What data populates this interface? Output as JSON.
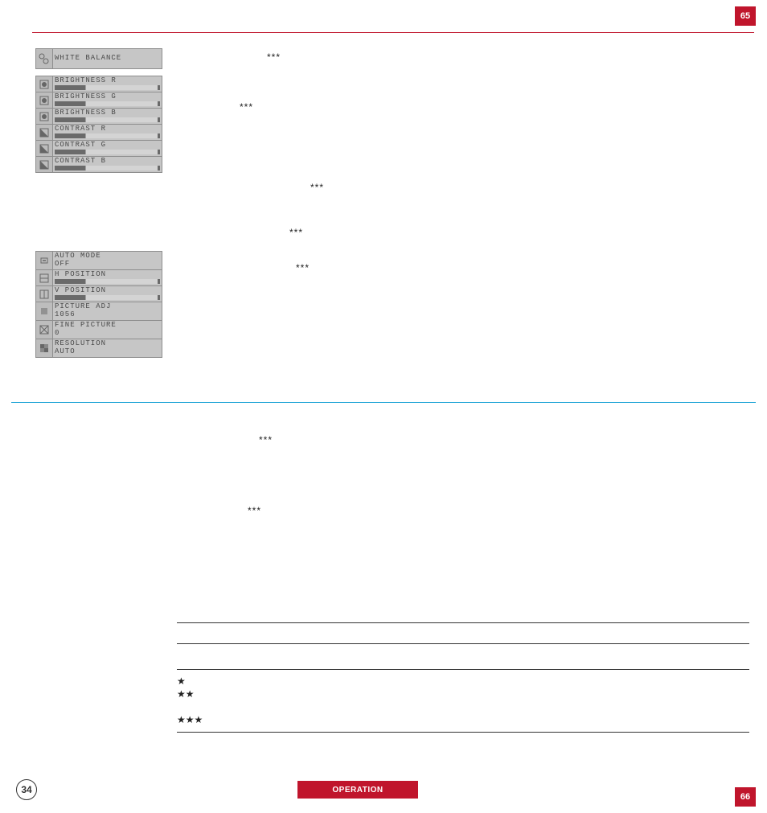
{
  "page_badges": {
    "top_right": "65",
    "bottom_right": "66",
    "bottom_left_circle": "34"
  },
  "footer_label": "OPERATION",
  "asterisk_marks": {
    "s1": "***",
    "s2": "***",
    "s3": "***",
    "s4": "***",
    "s5": "***",
    "s6": "***",
    "s7": "***"
  },
  "footnotes": {
    "star1": "★",
    "star2": "★★",
    "star3": "★★★"
  },
  "osd_menu_1": {
    "header": "WHITE BALANCE"
  },
  "osd_menu_2": {
    "rows": [
      {
        "label": "BRIGHTNESS R"
      },
      {
        "label": "BRIGHTNESS G"
      },
      {
        "label": "BRIGHTNESS B"
      },
      {
        "label": "CONTRAST R"
      },
      {
        "label": "CONTRAST G"
      },
      {
        "label": "CONTRAST B"
      }
    ]
  },
  "osd_menu_3": {
    "rows": [
      {
        "label": "AUTO MODE",
        "value": "OFF"
      },
      {
        "label": "H POSITION",
        "value": ""
      },
      {
        "label": "V POSITION",
        "value": ""
      },
      {
        "label": "PICTURE ADJ",
        "value": "1056"
      },
      {
        "label": "FINE PICTURE",
        "value": "0"
      },
      {
        "label": "RESOLUTION",
        "value": "AUTO"
      }
    ]
  }
}
